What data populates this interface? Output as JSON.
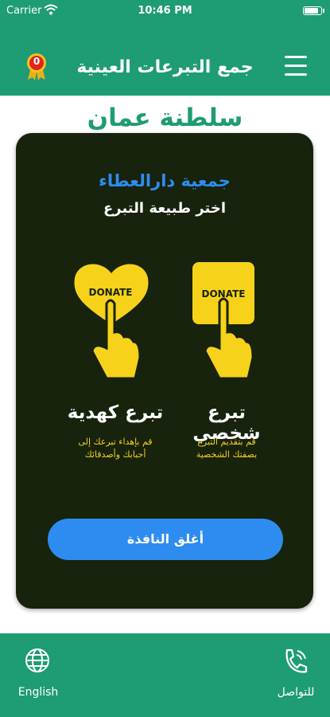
{
  "status_bar": {
    "carrier": "Carrier",
    "time": "10:46 PM"
  },
  "header": {
    "title": "جمع التبرعات العينية",
    "badge_count": "0"
  },
  "country": "سلطنة عمان",
  "dialog": {
    "org_name": "جمعية دارالعطاء",
    "prompt": "اختر طبيعة التبرع",
    "options": [
      {
        "title": "تبرع شخصي",
        "icon_text": "DONATE",
        "desc_line1": "قم بتقديم التبرع",
        "desc_line2": "بصفتك الشخصية"
      },
      {
        "title": "تبرع كهدية",
        "icon_text": "DONATE",
        "desc_line1": "قم بإهداء تبرعك إلى",
        "desc_line2": "أحبابك وأصدقائك"
      }
    ],
    "close_label": "أغلق النافذة"
  },
  "bottom_nav": {
    "language_label": "English",
    "contact_label": "للتواصل"
  },
  "colors": {
    "primary": "#1e9c74",
    "dialog_bg": "#17230d",
    "accent_blue": "#2e8cf0",
    "yellow": "#f6d21a"
  }
}
